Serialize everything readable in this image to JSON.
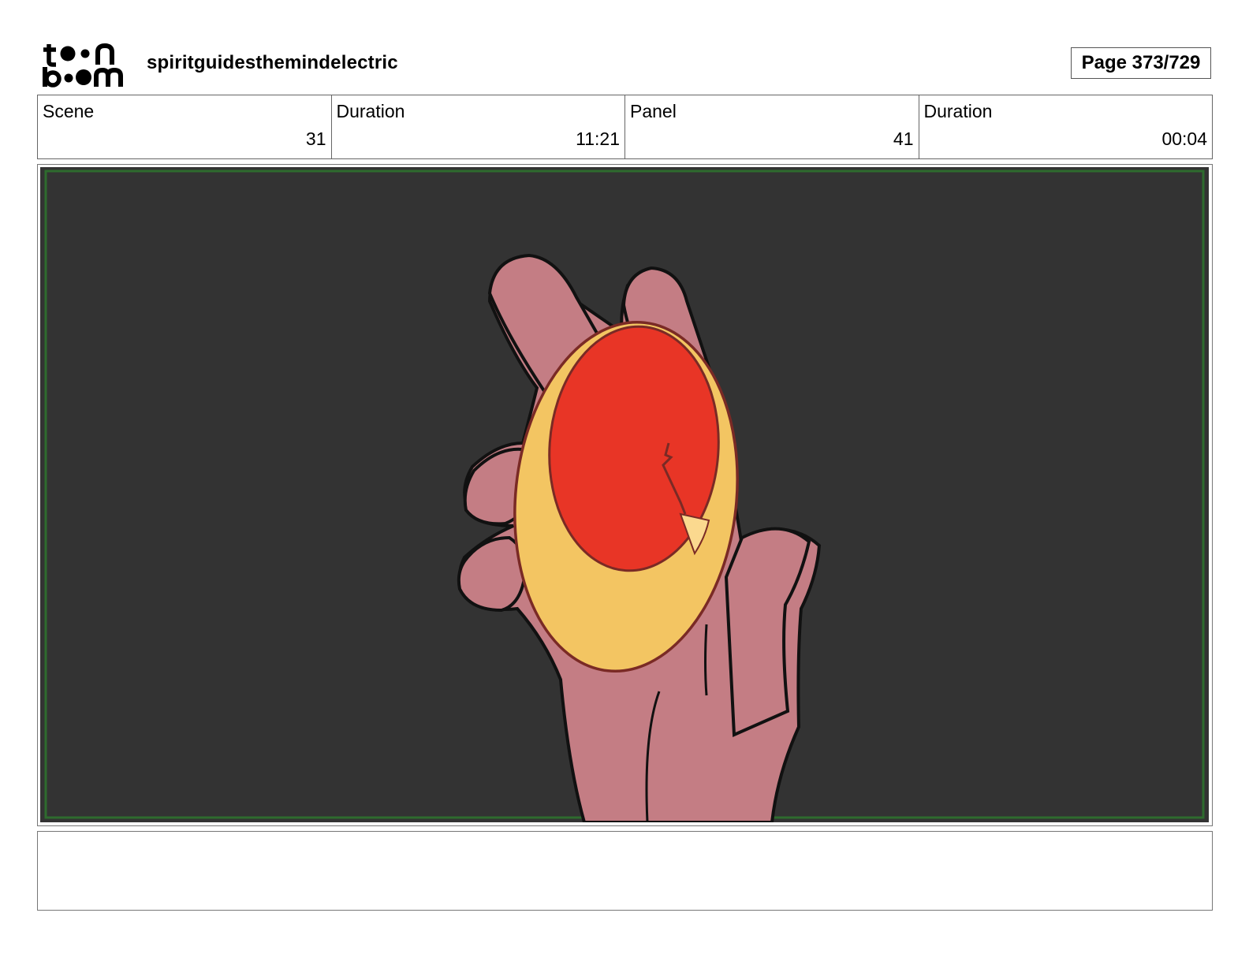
{
  "header": {
    "project_title": "spiritguidesthemindelectric",
    "page_indicator": "Page 373/729"
  },
  "info": {
    "scene_label": "Scene",
    "scene_value": "31",
    "scene_duration_label": "Duration",
    "scene_duration_value": "11:21",
    "panel_label": "Panel",
    "panel_value": "41",
    "panel_duration_label": "Duration",
    "panel_duration_value": "00:04"
  },
  "colors": {
    "panel_background": "#333333",
    "safe_frame": "#2e6b2e",
    "skin": "#c47d84",
    "gem_rim": "#f3c562",
    "gem_core": "#e83526",
    "gem_highlight": "#fbd98f",
    "outline": "#111111"
  },
  "notes": {
    "text": ""
  }
}
